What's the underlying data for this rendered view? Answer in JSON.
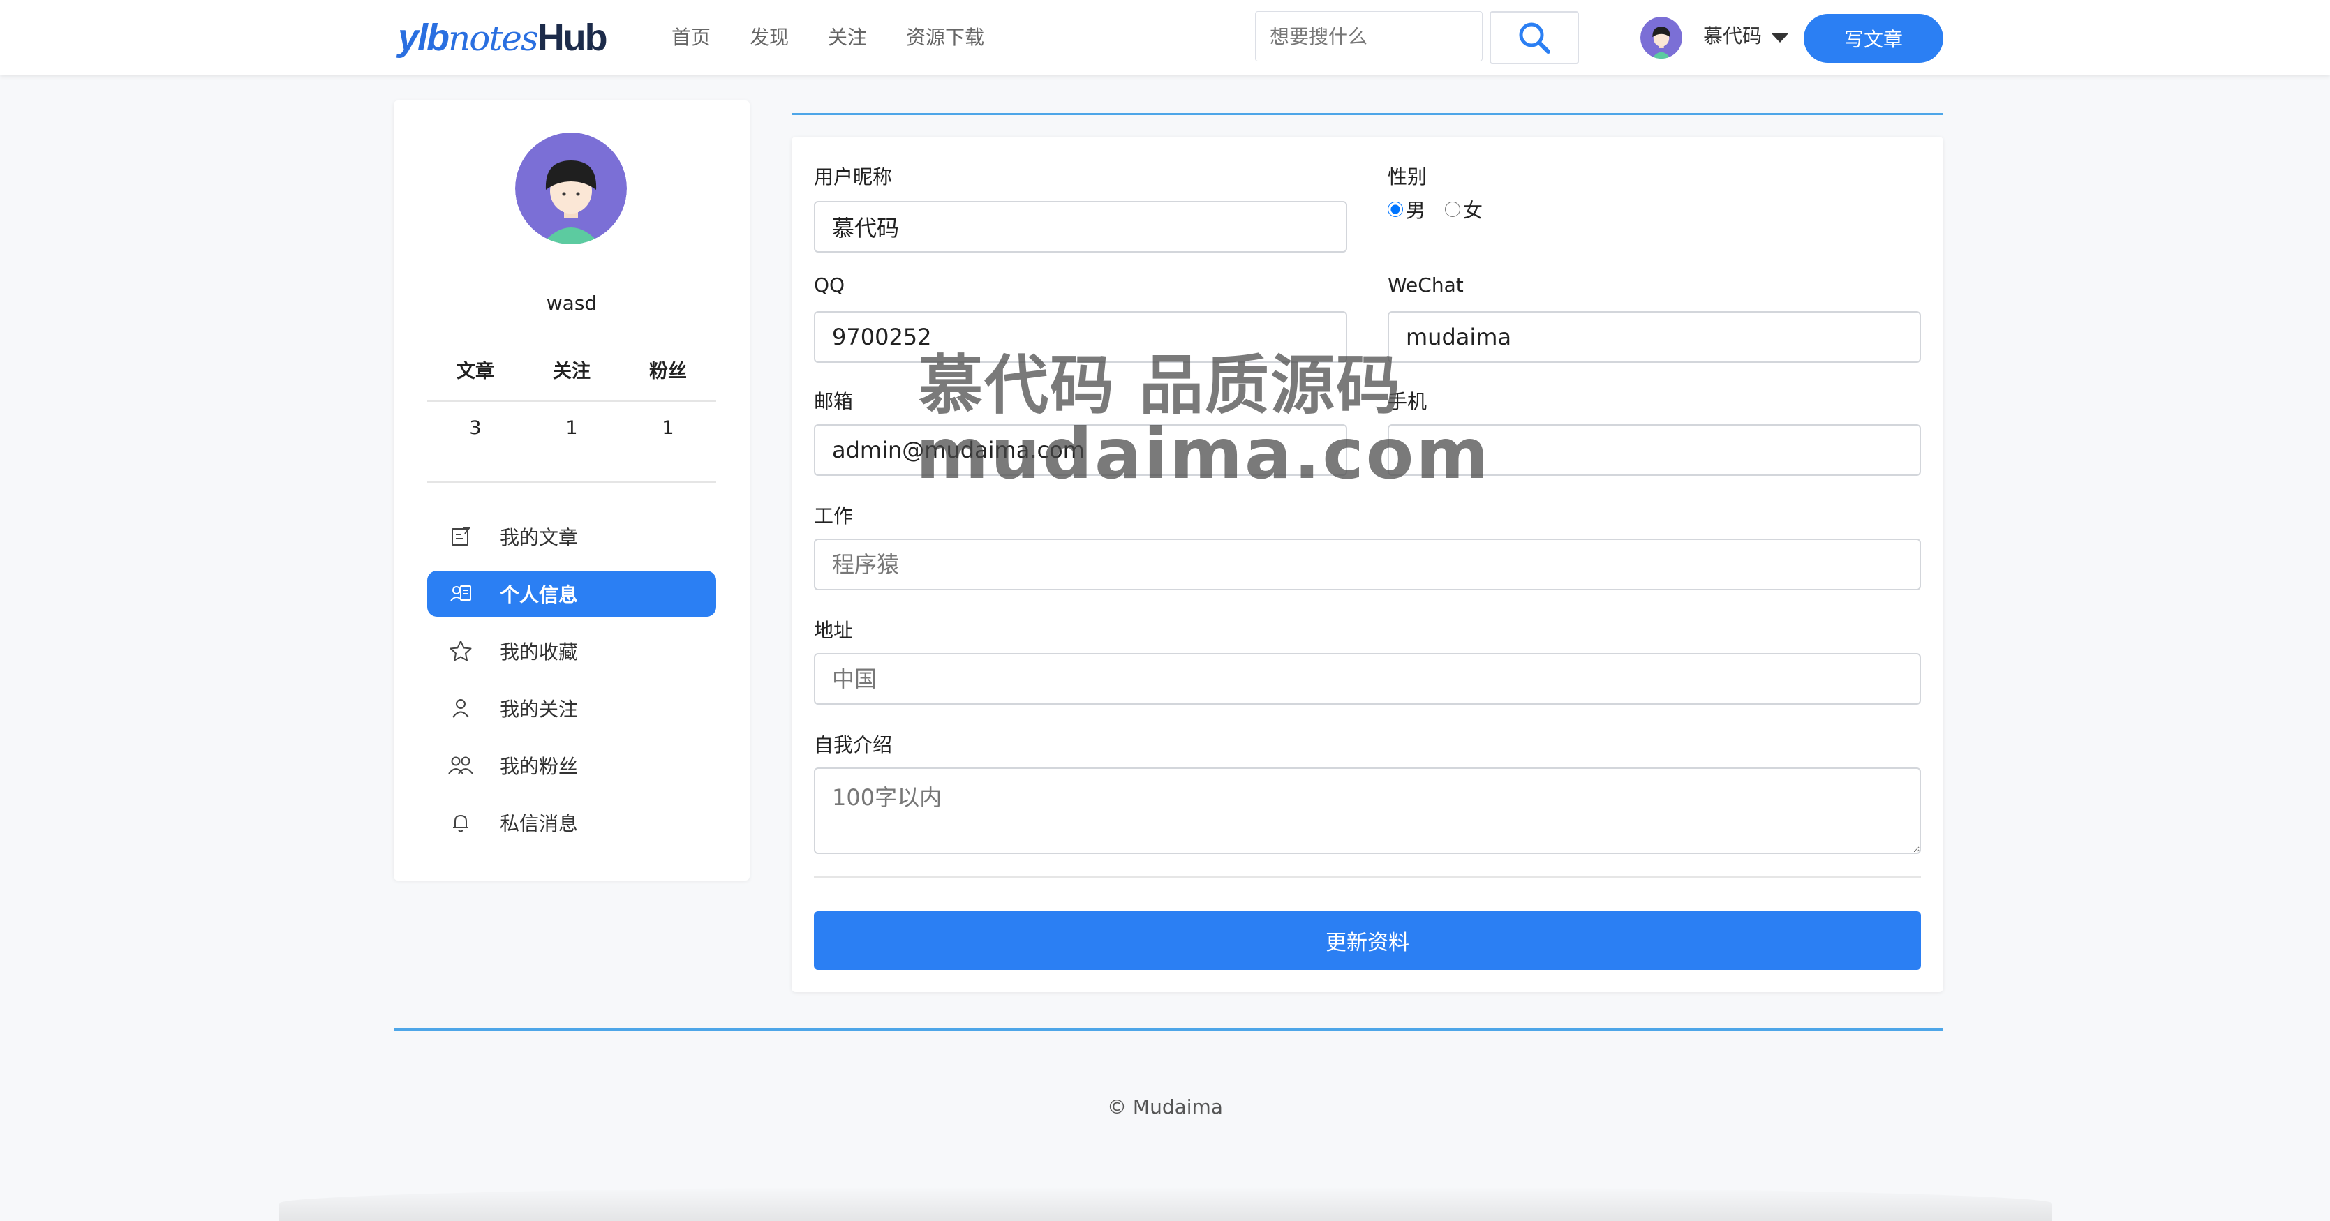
{
  "header": {
    "logo": {
      "part1": "ylb",
      "part2": "notes",
      "part3": "Hub"
    },
    "nav": [
      "首页",
      "发现",
      "关注",
      "资源下载"
    ],
    "search_placeholder": "想要搜什么",
    "user_name": "慕代码",
    "write_button": "写文章"
  },
  "sidebar": {
    "username": "wasd",
    "stats": {
      "labels": [
        "文章",
        "关注",
        "粉丝"
      ],
      "values": [
        "3",
        "1",
        "1"
      ]
    },
    "menu": [
      {
        "label": "我的文章",
        "icon": "edit-note-icon",
        "active": false
      },
      {
        "label": "个人信息",
        "icon": "id-card-icon",
        "active": true
      },
      {
        "label": "我的收藏",
        "icon": "star-icon",
        "active": false
      },
      {
        "label": "我的关注",
        "icon": "user-icon",
        "active": false
      },
      {
        "label": "我的粉丝",
        "icon": "users-icon",
        "active": false
      },
      {
        "label": "私信消息",
        "icon": "bell-icon",
        "active": false
      }
    ]
  },
  "form": {
    "nickname": {
      "label": "用户昵称",
      "value": "慕代码"
    },
    "gender": {
      "label": "性别",
      "options": [
        "男",
        "女"
      ],
      "selected": "男"
    },
    "qq": {
      "label": "QQ",
      "value": "9700252"
    },
    "wechat": {
      "label": "WeChat",
      "value": "mudaima"
    },
    "email": {
      "label": "邮箱",
      "value": "admin@mudaima.com"
    },
    "phone": {
      "label": "手机",
      "value": ""
    },
    "job": {
      "label": "工作",
      "placeholder": "程序猿"
    },
    "address": {
      "label": "地址",
      "placeholder": "中国"
    },
    "bio": {
      "label": "自我介绍",
      "placeholder": "100字以内"
    },
    "submit": "更新资料"
  },
  "watermark": {
    "line1": "慕代码 品质源码",
    "line2": "mudaima.com"
  },
  "footer": {
    "copyright": "© Mudaima"
  },
  "colors": {
    "primary": "#2b7ff3",
    "accent_line": "#4ea6e8"
  }
}
